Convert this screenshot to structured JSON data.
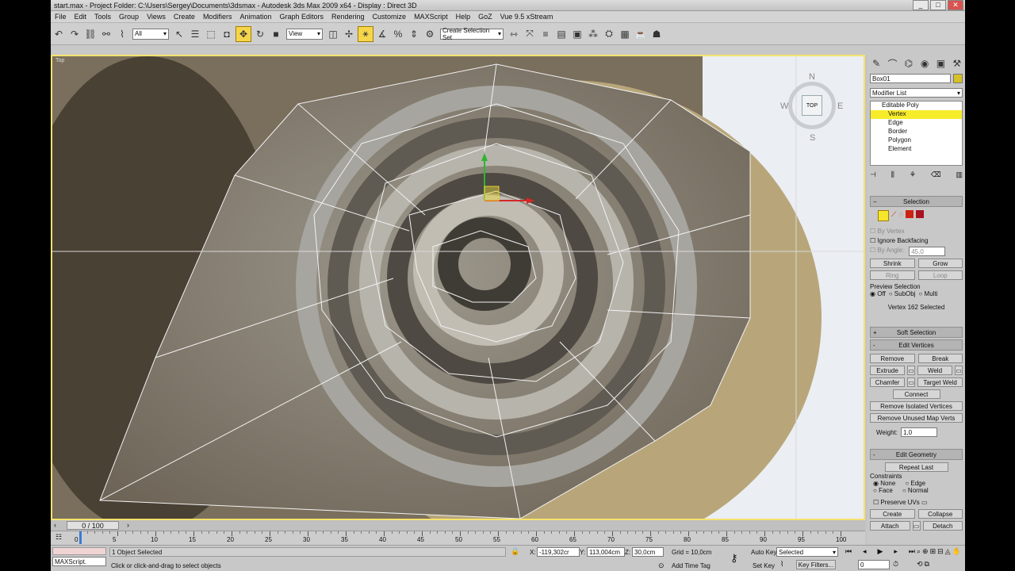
{
  "window": {
    "title": "start.max   - Project Folder: C:\\Users\\Sergey\\Documents\\3dsmax   - Autodesk 3ds Max  2009 x64   - Display : Direct 3D",
    "minimize": "_",
    "maximize": "□",
    "close": "✕"
  },
  "menu": [
    "File",
    "Edit",
    "Tools",
    "Group",
    "Views",
    "Create",
    "Modifiers",
    "Animation",
    "Graph Editors",
    "Rendering",
    "Customize",
    "MAXScript",
    "Help",
    "GoZ",
    "Vue 9.5 xStream"
  ],
  "toolbar": {
    "filter_value": "All",
    "refcoord_value": "View",
    "named_selection_placeholder": "Create Selection Set",
    "icons": [
      "undo-icon",
      "redo-icon",
      "link-icon",
      "unlink-icon",
      "bind-space-warp-icon",
      "select-filter",
      "select-object-icon",
      "select-by-name-icon",
      "rect-select-icon",
      "window-crossing-icon",
      "move-icon",
      "rotate-icon",
      "scale-icon",
      "ref-coord",
      "pivot-icon",
      "manipulate-icon",
      "snap-icon",
      "angle-snap-icon",
      "percent-snap-icon",
      "spinner-snap-icon",
      "edit-named-selections-icon",
      "mirror-icon",
      "align-icon",
      "layer-manager-icon",
      "curve-editor-icon",
      "schematic-view-icon",
      "material-editor-icon",
      "render-setup-icon",
      "render-frame-icon",
      "quick-render-icon"
    ]
  },
  "viewport": {
    "label": "Top",
    "viewcube": {
      "n": "N",
      "s": "S",
      "e": "E",
      "w": "W",
      "face": "TOP"
    }
  },
  "command_panel": {
    "object_name": "Box01",
    "modifier_list": "Modifier List",
    "stack": [
      {
        "label": "Editable Poly",
        "selected": false
      },
      {
        "label": "Vertex",
        "selected": true
      },
      {
        "label": "Edge",
        "selected": false
      },
      {
        "label": "Border",
        "selected": false
      },
      {
        "label": "Polygon",
        "selected": false
      },
      {
        "label": "Element",
        "selected": false
      }
    ],
    "selection": {
      "title": "Selection",
      "by_vertex": "By Vertex",
      "ignore_backfacing": "Ignore Backfacing",
      "by_angle": "By Angle:",
      "by_angle_value": "45,0",
      "shrink": "Shrink",
      "grow": "Grow",
      "ring": "Ring",
      "loop": "Loop",
      "preview_title": "Preview Selection",
      "preview_off": "Off",
      "preview_subobj": "SubObj",
      "preview_multi": "Multi",
      "status": "Vertex 162 Selected"
    },
    "soft_selection": {
      "title": "Soft Selection",
      "pm": "+"
    },
    "edit_vertices": {
      "title": "Edit Vertices",
      "pm": "-",
      "remove": "Remove",
      "break": "Break",
      "extrude": "Extrude",
      "weld": "Weld",
      "chamfer": "Chamfer",
      "target_weld": "Target Weld",
      "connect": "Connect",
      "remove_isolated": "Remove Isolated Vertices",
      "remove_unused": "Remove Unused Map Verts",
      "weight_label": "Weight:",
      "weight_value": "1,0"
    },
    "edit_geometry": {
      "title": "Edit Geometry",
      "pm": "-",
      "repeat_last": "Repeat Last",
      "constraints": "Constraints",
      "none": "None",
      "edge": "Edge",
      "face": "Face",
      "normal": "Normal",
      "preserve_uvs": "Preserve UVs",
      "create": "Create",
      "collapse": "Collapse",
      "attach": "Attach",
      "detach": "Detach"
    }
  },
  "timeline": {
    "frame_label": "0 / 100",
    "ticks": [
      "0",
      "5",
      "10",
      "15",
      "20",
      "25",
      "30",
      "35",
      "40",
      "45",
      "50",
      "55",
      "60",
      "65",
      "70",
      "75",
      "80",
      "85",
      "90",
      "95",
      "100"
    ],
    "progress": 0.0
  },
  "statusbar": {
    "maxscript": "MAXScript.",
    "objects_selected": "1 Object Selected",
    "prompt": "Click or click-and-drag to select objects",
    "x_label": "X:",
    "x_value": "-119,302cr",
    "y_label": "Y:",
    "y_value": "113,004cm",
    "z_label": "Z:",
    "z_value": "30,0cm",
    "grid": "Grid = 10,0cm",
    "add_time_tag": "Add Time Tag",
    "auto_key": "Auto Key",
    "set_key": "Set Key",
    "key_mode": "Selected",
    "key_filters": "Key Filters...",
    "current_frame": "0"
  }
}
